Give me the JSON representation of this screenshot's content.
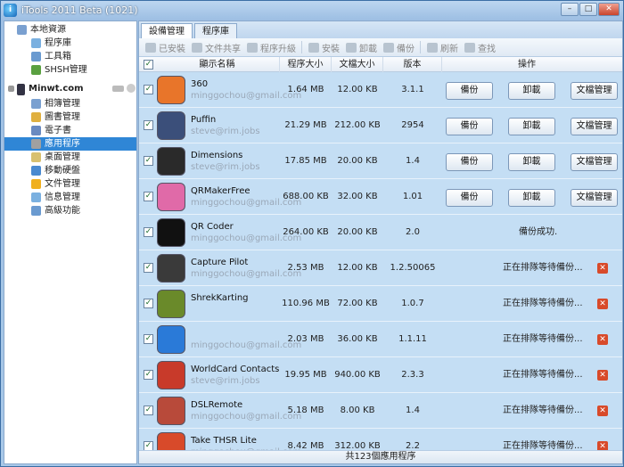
{
  "window": {
    "title": "iTools 2011 Beta (1021)",
    "logo_glyph": "i"
  },
  "sidebar": {
    "local_header": "本地資源",
    "local_items": [
      "程序庫",
      "工具箱",
      "SHSH管理"
    ],
    "device": "Minwt.com",
    "device_items": [
      "相簿管理",
      "圖書管理",
      "電子書",
      "應用程序",
      "桌面管理",
      "移動硬盤",
      "文件管理",
      "信息管理",
      "高級功能"
    ],
    "selected": "應用程序"
  },
  "tabs": [
    "設備管理",
    "程序庫"
  ],
  "toolbar": [
    "已安裝",
    "文件共享",
    "程序升級",
    "安裝",
    "卸載",
    "備份",
    "刷新",
    "查找"
  ],
  "columns": {
    "name": "顯示名稱",
    "app_size": "程序大小",
    "doc_size": "文檔大小",
    "version": "版本",
    "ops": "操作"
  },
  "buttons": {
    "backup": "備份",
    "uninstall": "卸載",
    "docs": "文檔管理"
  },
  "apps": [
    {
      "name": "360",
      "email": "minggochou@gmail.com",
      "size": "1.64 MB",
      "docs": "12.00 KB",
      "ver": "3.1.1",
      "state": "buttons",
      "color": "#e8752a"
    },
    {
      "name": "Puffin",
      "email": "steve@rim.jobs",
      "size": "21.29 MB",
      "docs": "212.00 KB",
      "ver": "2954",
      "state": "buttons",
      "color": "#3b4f7a"
    },
    {
      "name": "Dimensions",
      "email": "steve@rim.jobs",
      "size": "17.85 MB",
      "docs": "20.00 KB",
      "ver": "1.4",
      "state": "buttons",
      "color": "#2a2a2a"
    },
    {
      "name": "QRMakerFree",
      "email": "minggochou@gmail.com",
      "size": "688.00 KB",
      "docs": "32.00 KB",
      "ver": "1.01",
      "state": "buttons",
      "color": "#e06aa8"
    },
    {
      "name": "QR Coder",
      "email": "minggochou@gmail.com",
      "size": "264.00 KB",
      "docs": "20.00 KB",
      "ver": "2.0",
      "state": "done",
      "status": "備份成功.",
      "color": "#111111"
    },
    {
      "name": "Capture Pilot",
      "email": "minggochou@gmail.com",
      "size": "2.53 MB",
      "docs": "12.00 KB",
      "ver": "1.2.50065",
      "state": "queue",
      "status": "正在排隊等待備份...",
      "color": "#3a3a3a"
    },
    {
      "name": "ShrekKarting",
      "email": "",
      "size": "110.96 MB",
      "docs": "72.00 KB",
      "ver": "1.0.7",
      "state": "queue",
      "status": "正在排隊等待備份...",
      "color": "#6a8a2a"
    },
    {
      "name": "",
      "email": "minggochou@gmail.com",
      "size": "2.03 MB",
      "docs": "36.00 KB",
      "ver": "1.1.11",
      "state": "queue",
      "status": "正在排隊等待備份...",
      "color": "#2a7ad8"
    },
    {
      "name": "WorldCard Contacts",
      "email": "steve@rim.jobs",
      "size": "19.95 MB",
      "docs": "940.00 KB",
      "ver": "2.3.3",
      "state": "queue",
      "status": "正在排隊等待備份...",
      "color": "#c83a2a"
    },
    {
      "name": "DSLRemote",
      "email": "minggochou@gmail.com",
      "size": "5.18 MB",
      "docs": "8.00 KB",
      "ver": "1.4",
      "state": "queue",
      "status": "正在排隊等待備份...",
      "color": "#b84a3a"
    },
    {
      "name": "Take THSR Lite",
      "email": "minggochou@gmail.com",
      "size": "8.42 MB",
      "docs": "312.00 KB",
      "ver": "2.2",
      "state": "queue",
      "status": "正在排隊等待備份...",
      "color": "#d84a2a"
    }
  ],
  "footer": "共123個應用程序"
}
